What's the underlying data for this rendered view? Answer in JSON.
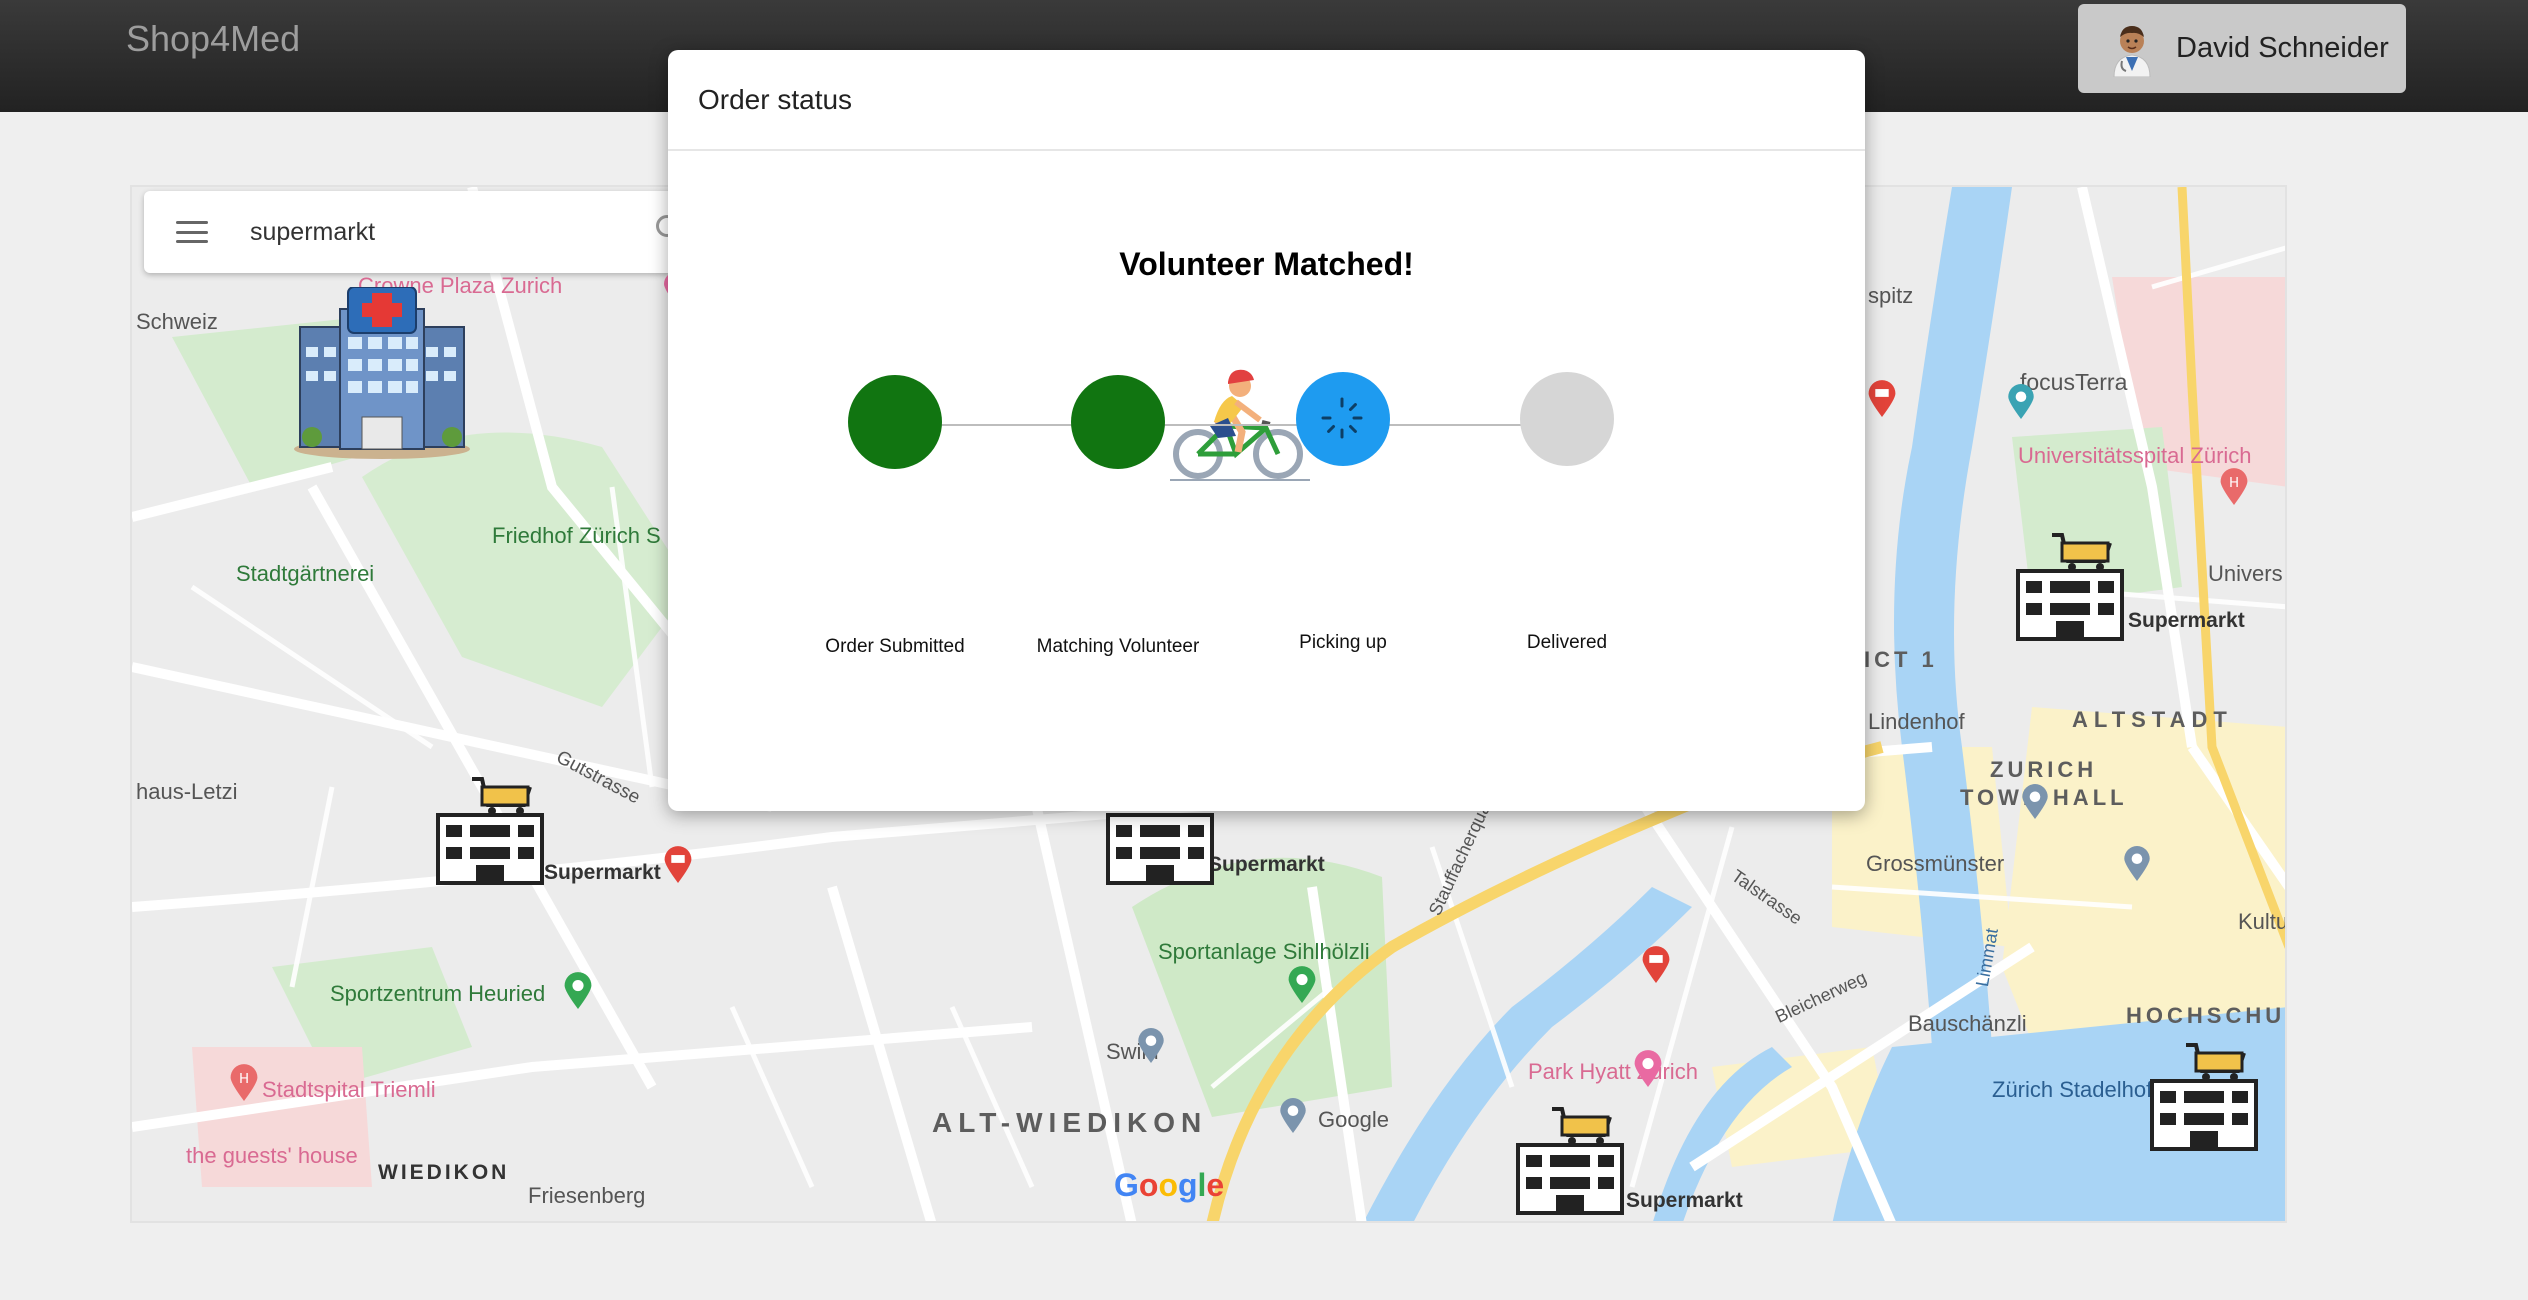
{
  "header": {
    "brand": "Shop4Med",
    "user_name": "David Schneider"
  },
  "map": {
    "search_value": "supermarkt",
    "labels": {
      "crowne_plaza": "Crowne Plaza Zurich",
      "schweiz": "Schweiz",
      "stadtgartnerei": "Stadtgärtnerei",
      "friedhof": "Friedhof Zürich S",
      "gutstrasse": "Gutstrasse",
      "haus_letzi": "haus-Letzi",
      "supermarkt_1": "Supermarkt",
      "supermarkt_2": "Supermarkt",
      "supermarkt_3": "Supermarkt",
      "supermarkt_4": "Supermarkt",
      "sportzentrum": "Sportzentrum Heuried",
      "sportanlage": "Sportanlage Sihlhölzli",
      "swild": "Swild",
      "google_place": "Google",
      "stadtspital": "Stadtspital Triemli",
      "guests_house": "the guests' house",
      "wiedikon": "WIEDIKON",
      "friesenberg": "Friesenberg",
      "alt_wiedikon": "ALT-WIEDIKON",
      "park_hyatt": "Park Hyatt Zürich",
      "focus_terra": "focusTerra",
      "universitatsspital": "Universitätsspital Zürich",
      "univers": "Univers",
      "lindenhof": "Lindenhof",
      "altstadt": "ALTSTADT",
      "zurich_town_hall_1": "ZURICH",
      "zurich_town_hall_2": "TOWN HALL",
      "grossmunster": "Grossmünster",
      "bauschanzli": "Bauschänzli",
      "stadelhofen": "Zürich Stadelhofen",
      "hochschul": "HOCHSCHUL",
      "kultu": "Kultu",
      "spitz": "spitz",
      "ict1": "ICT 1",
      "limmat": "Limmat",
      "talstrasse": "Talstrasse",
      "bleicherweg": "Bleicherweg",
      "stauffacherquai": "Stauffacherquai",
      "google_logo": "Google"
    },
    "colors": {
      "water": "#a9d4f5",
      "park": "#cde8c5",
      "road": "#ffffff",
      "major_road": "#f8d56b",
      "oldtown": "#fbf2c9"
    }
  },
  "modal": {
    "title": "Order status",
    "heading": "Volunteer Matched!",
    "steps": [
      {
        "label": "Order Submitted",
        "state": "done",
        "color": "#117511"
      },
      {
        "label": "Matching Volunteer",
        "state": "done",
        "color": "#117511"
      },
      {
        "label": "Picking up",
        "state": "active",
        "color": "#1e9bf0"
      },
      {
        "label": "Delivered",
        "state": "pending",
        "color": "#d6d6d6"
      }
    ]
  }
}
